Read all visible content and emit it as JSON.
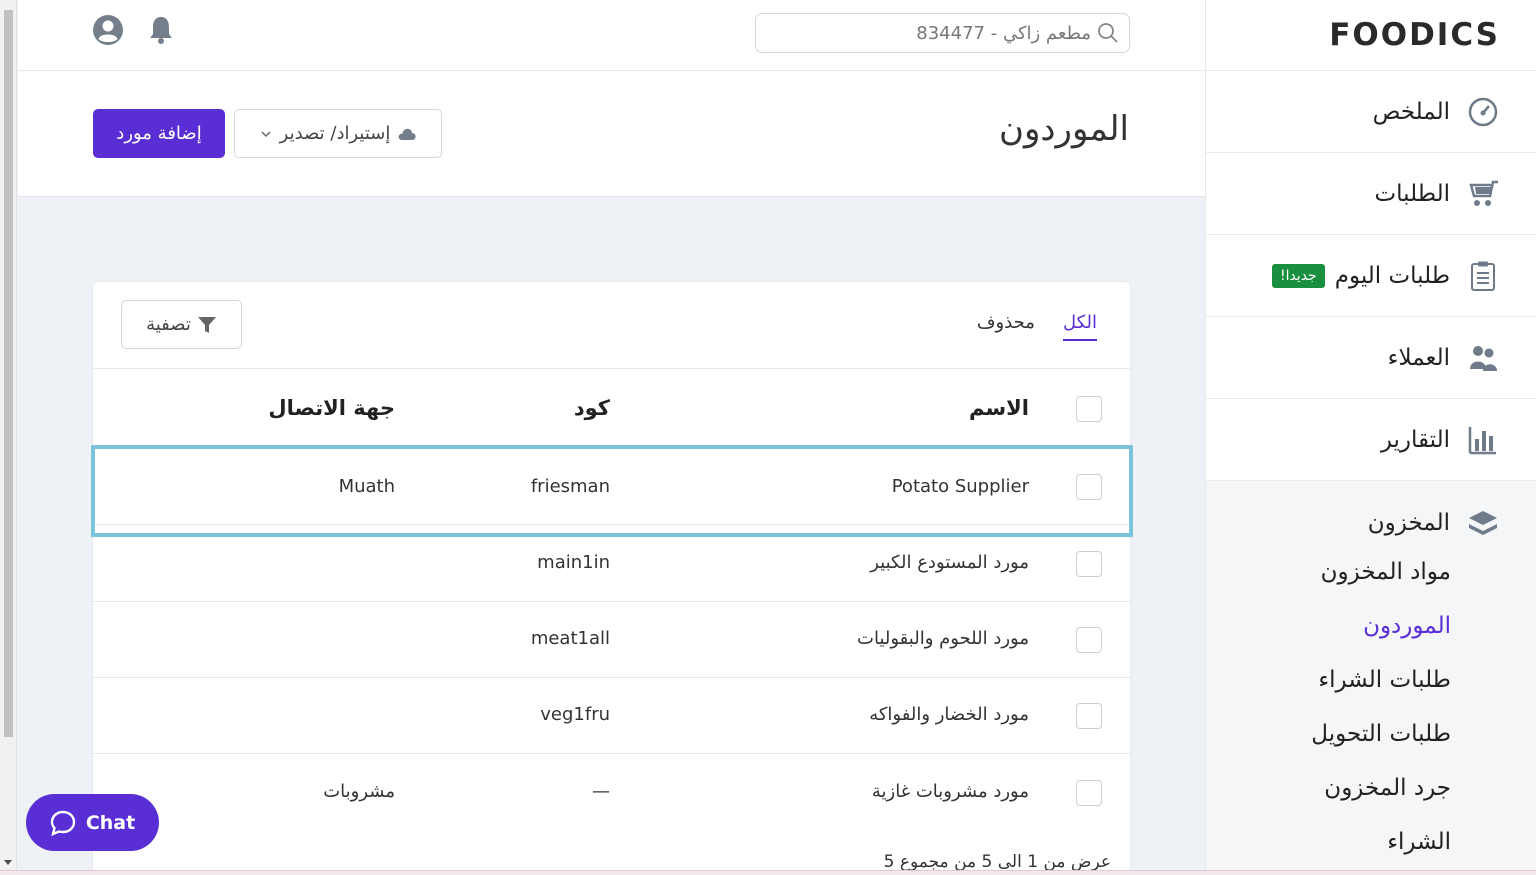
{
  "brand": {
    "logo_text": "FOODICS"
  },
  "topbar": {
    "search_placeholder": "مطعم زاكي - 834477"
  },
  "sidebar": {
    "items": [
      {
        "label": "الملخص",
        "icon": "dashboard-gauge-icon"
      },
      {
        "label": "الطلبات",
        "icon": "cart-icon"
      },
      {
        "label": "طلبات اليوم",
        "icon": "clipboard-icon",
        "badge": "جديدا!"
      },
      {
        "label": "العملاء",
        "icon": "customers-icon"
      },
      {
        "label": "التقارير",
        "icon": "bar-chart-icon"
      }
    ],
    "inventory": {
      "label": "المخزون",
      "icon": "layers-icon",
      "sub_items": [
        {
          "label": "مواد المخزون",
          "active": false
        },
        {
          "label": "الموردون",
          "active": true
        },
        {
          "label": "طلبات الشراء",
          "active": false
        },
        {
          "label": "طلبات التحويل",
          "active": false
        },
        {
          "label": "جرد المخزون",
          "active": false
        },
        {
          "label": "الشراء",
          "active": false
        }
      ]
    }
  },
  "page": {
    "title": "الموردون",
    "add_button": "إضافة مورد",
    "import_export_button": "إستيراد/ تصدير"
  },
  "card": {
    "tabs": [
      {
        "label": "الكل",
        "active": true
      },
      {
        "label": "محذوف",
        "active": false
      }
    ],
    "filter_button": "تصفية",
    "columns": {
      "name": "الاسم",
      "code": "كود",
      "contact": "جهة الاتصال"
    },
    "rows": [
      {
        "name": "Potato Supplier",
        "code": "friesman",
        "contact": "Muath"
      },
      {
        "name": "مورد المستودع الكبير",
        "code": "main1in",
        "contact": ""
      },
      {
        "name": "مورد اللحوم والبقوليات",
        "code": "meat1all",
        "contact": ""
      },
      {
        "name": "مورد الخضار والفواكه",
        "code": "veg1fru",
        "contact": ""
      },
      {
        "name": "مورد مشروبات غازية",
        "code": "—",
        "contact": "مشروبات"
      }
    ],
    "pagination_text": "عرض من 1 الى 5 من مجموع 5"
  },
  "chat": {
    "label": "Chat"
  },
  "colors": {
    "accent": "#5a2ed5",
    "badge": "#1a8f3f",
    "highlight": "#7cc4dc"
  }
}
